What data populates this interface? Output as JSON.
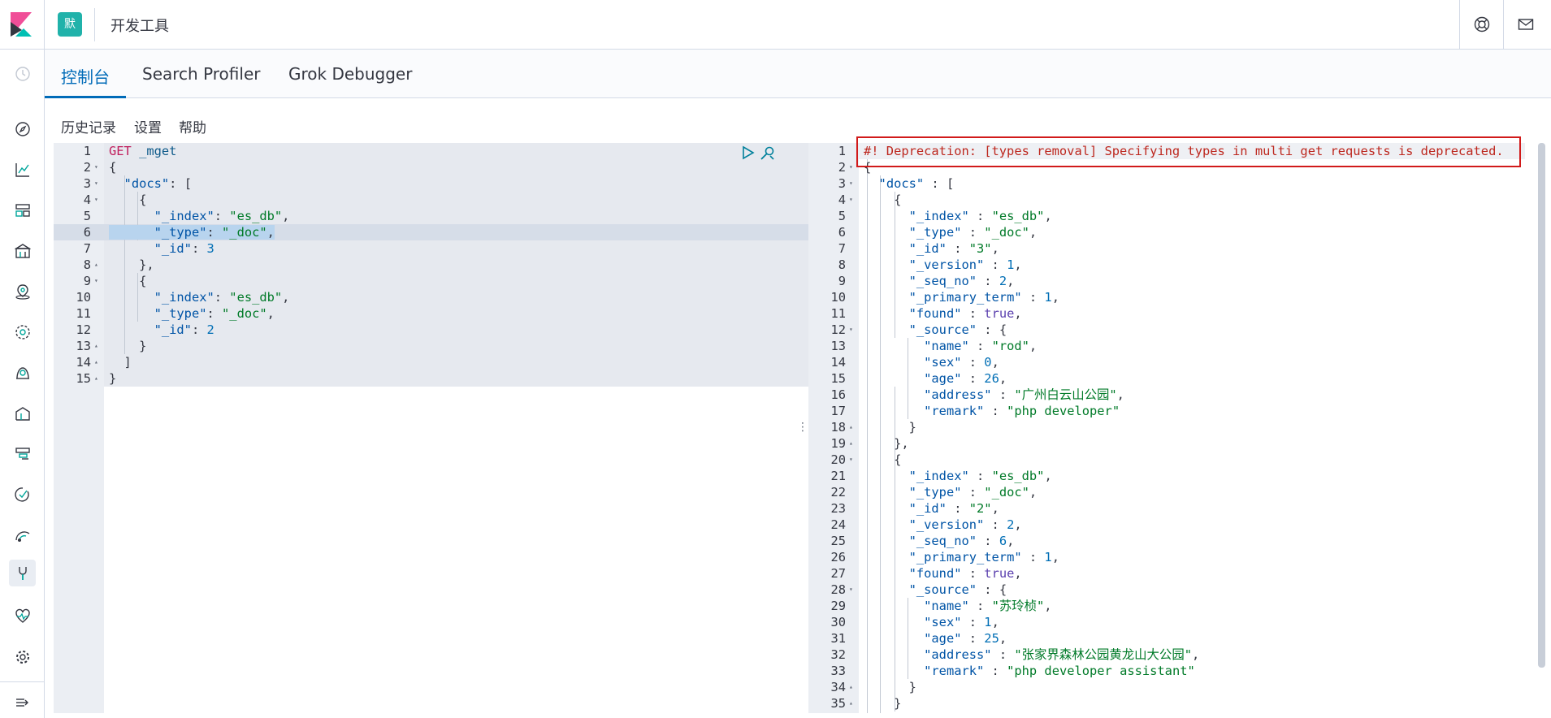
{
  "header": {
    "space_avatar": "默",
    "title": "开发工具",
    "help_icon": "lifebuoy-icon",
    "mail_icon": "mail-icon"
  },
  "tabs": [
    {
      "label": "控制台",
      "active": true
    },
    {
      "label": "Search Profiler",
      "active": false
    },
    {
      "label": "Grok Debugger",
      "active": false
    }
  ],
  "toolbar": {
    "history": "历史记录",
    "settings": "设置",
    "help": "帮助"
  },
  "colors": {
    "accent": "#006bb8",
    "deprecation": "#bd271e",
    "string": "#007a28",
    "number": "#006eb5",
    "method": "#c01c5b"
  },
  "request_lines": [
    {
      "n": "1",
      "text": "GET _mget"
    },
    {
      "n": "2",
      "text": "{"
    },
    {
      "n": "3",
      "text": "  \"docs\": ["
    },
    {
      "n": "4",
      "text": "    {"
    },
    {
      "n": "5",
      "text": "      \"_index\": \"es_db\","
    },
    {
      "n": "6",
      "text": "      \"_type\": \"_doc\","
    },
    {
      "n": "7",
      "text": "      \"_id\": 3"
    },
    {
      "n": "8",
      "text": "    },"
    },
    {
      "n": "9",
      "text": "    {"
    },
    {
      "n": "10",
      "text": "      \"_index\": \"es_db\","
    },
    {
      "n": "11",
      "text": "      \"_type\": \"_doc\","
    },
    {
      "n": "12",
      "text": "      \"_id\": 2"
    },
    {
      "n": "13",
      "text": "    }"
    },
    {
      "n": "14",
      "text": "  ]"
    },
    {
      "n": "15",
      "text": "}"
    }
  ],
  "response_lines": [
    {
      "n": "1",
      "text": "#! Deprecation: [types removal] Specifying types in multi get requests is deprecated."
    },
    {
      "n": "2",
      "text": "{"
    },
    {
      "n": "3",
      "text": "  \"docs\" : ["
    },
    {
      "n": "4",
      "text": "    {"
    },
    {
      "n": "5",
      "text": "      \"_index\" : \"es_db\","
    },
    {
      "n": "6",
      "text": "      \"_type\" : \"_doc\","
    },
    {
      "n": "7",
      "text": "      \"_id\" : \"3\","
    },
    {
      "n": "8",
      "text": "      \"_version\" : 1,"
    },
    {
      "n": "9",
      "text": "      \"_seq_no\" : 2,"
    },
    {
      "n": "10",
      "text": "      \"_primary_term\" : 1,"
    },
    {
      "n": "11",
      "text": "      \"found\" : true,"
    },
    {
      "n": "12",
      "text": "      \"_source\" : {"
    },
    {
      "n": "13",
      "text": "        \"name\" : \"rod\","
    },
    {
      "n": "14",
      "text": "        \"sex\" : 0,"
    },
    {
      "n": "15",
      "text": "        \"age\" : 26,"
    },
    {
      "n": "16",
      "text": "        \"address\" : \"广州白云山公园\","
    },
    {
      "n": "17",
      "text": "        \"remark\" : \"php developer\""
    },
    {
      "n": "18",
      "text": "      }"
    },
    {
      "n": "19",
      "text": "    },"
    },
    {
      "n": "20",
      "text": "    {"
    },
    {
      "n": "21",
      "text": "      \"_index\" : \"es_db\","
    },
    {
      "n": "22",
      "text": "      \"_type\" : \"_doc\","
    },
    {
      "n": "23",
      "text": "      \"_id\" : \"2\","
    },
    {
      "n": "24",
      "text": "      \"_version\" : 2,"
    },
    {
      "n": "25",
      "text": "      \"_seq_no\" : 6,"
    },
    {
      "n": "26",
      "text": "      \"_primary_term\" : 1,"
    },
    {
      "n": "27",
      "text": "      \"found\" : true,"
    },
    {
      "n": "28",
      "text": "      \"_source\" : {"
    },
    {
      "n": "29",
      "text": "        \"name\" : \"苏玲桢\","
    },
    {
      "n": "30",
      "text": "        \"sex\" : 1,"
    },
    {
      "n": "31",
      "text": "        \"age\" : 25,"
    },
    {
      "n": "32",
      "text": "        \"address\" : \"张家界森林公园黄龙山大公园\","
    },
    {
      "n": "33",
      "text": "        \"remark\" : \"php developer assistant\""
    },
    {
      "n": "34",
      "text": "      }"
    },
    {
      "n": "35",
      "text": "    }"
    }
  ],
  "sidebar_icons": [
    "recent-clock-icon",
    "discover-compass-icon",
    "visualize-chart-icon",
    "dashboard-icon",
    "canvas-icon",
    "maps-icon",
    "ml-icon",
    "siem-icon",
    "logs-icon",
    "apm-icon",
    "uptime-icon",
    "metrics-icon",
    "dev-tools-wrench-icon",
    "monitoring-heartbeat-icon",
    "management-gear-icon",
    "collapse-nav-icon"
  ]
}
